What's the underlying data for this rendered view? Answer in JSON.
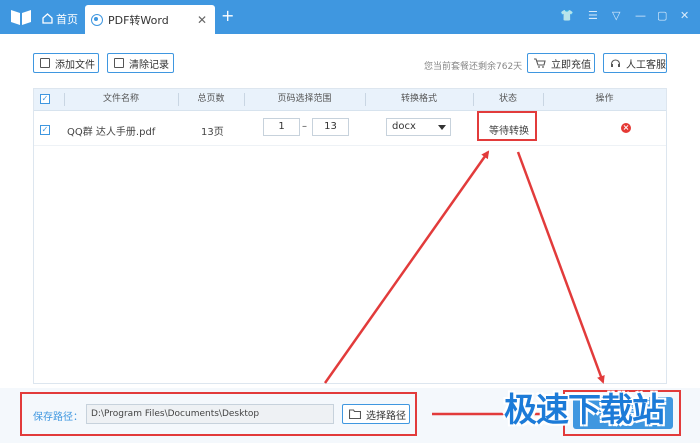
{
  "tabs": {
    "home": "首页",
    "active": "PDF转Word",
    "close": "✕",
    "add": "+"
  },
  "window_controls": [
    "👕",
    "☰",
    "▽",
    "—",
    "▢",
    "✕"
  ],
  "toolbar": {
    "add_files": "添加文件",
    "clear_records": "清除记录",
    "remaining": "您当前套餐还剩余762天",
    "recharge": "立即充值",
    "support": "人工客服"
  },
  "table": {
    "headers": [
      "文件名称",
      "总页数",
      "页码选择范围",
      "转换格式",
      "状态",
      "操作"
    ],
    "rows": [
      {
        "name": "QQ群 达人手册.pdf",
        "pages": "13页",
        "from": "1",
        "dash": "–",
        "to": "13",
        "format": "docx",
        "status": "等待转换"
      }
    ]
  },
  "footer": {
    "path_label": "保存路径：",
    "path_value": "D:\\Program Files\\Documents\\Desktop",
    "choose_path": "选择路径",
    "start": "开始转换"
  },
  "watermark": "极速下载站",
  "colors": {
    "accent": "#3f97e0",
    "annotation_red": "#e23b3b",
    "delete_red": "#e53935"
  },
  "icons": [
    "logo-book-icon",
    "home-icon",
    "pdf-tab-icon",
    "file-add-icon",
    "trash-icon",
    "cart-icon",
    "headset-icon",
    "folder-icon",
    "delete-icon"
  ]
}
